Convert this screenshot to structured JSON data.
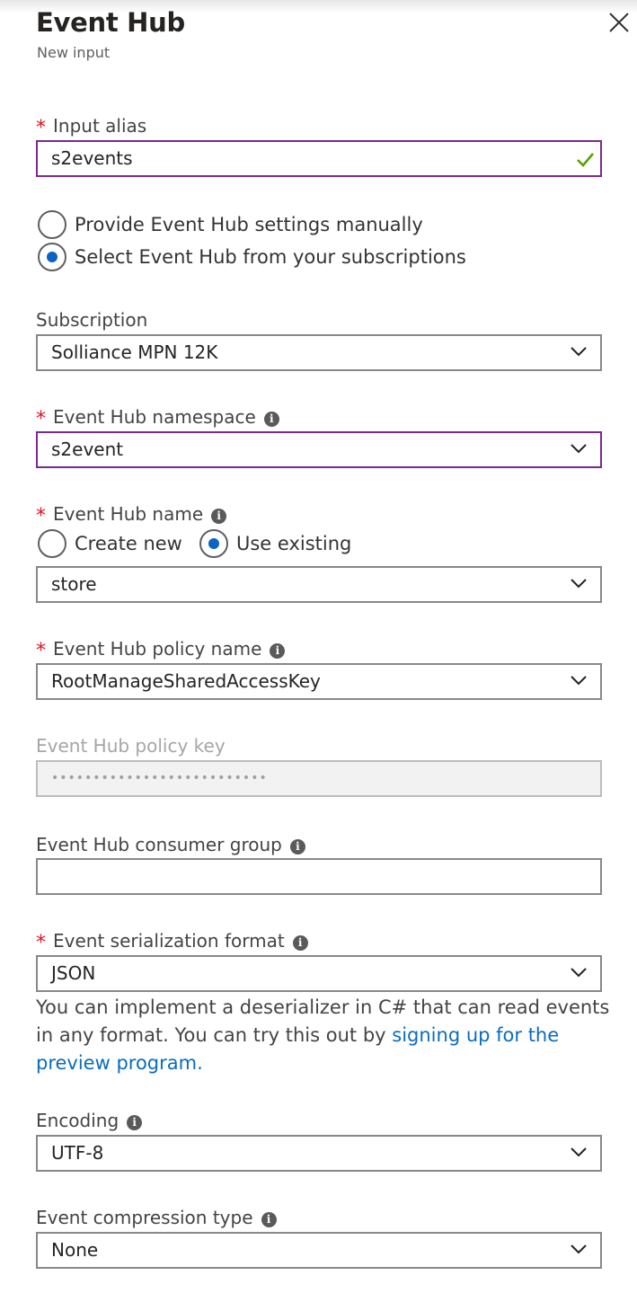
{
  "header": {
    "title": "Event Hub",
    "subtitle": "New input"
  },
  "input_alias": {
    "label": "Input alias",
    "value": "s2events",
    "required": true,
    "valid": true
  },
  "source_options": [
    {
      "label": "Provide Event Hub settings manually",
      "selected": false
    },
    {
      "label": "Select Event Hub from your subscriptions",
      "selected": true
    }
  ],
  "subscription": {
    "label": "Subscription",
    "value": "Solliance MPN 12K"
  },
  "namespace": {
    "label": "Event Hub namespace",
    "value": "s2event",
    "required": true
  },
  "hub_name": {
    "label": "Event Hub name",
    "required": true,
    "options": [
      {
        "label": "Create new",
        "selected": false
      },
      {
        "label": "Use existing",
        "selected": true
      }
    ],
    "value": "store"
  },
  "policy_name": {
    "label": "Event Hub policy name",
    "value": "RootManageSharedAccessKey",
    "required": true
  },
  "policy_key": {
    "label": "Event Hub policy key",
    "value": "••••••••••••••••••••••••••",
    "disabled": true
  },
  "consumer_group": {
    "label": "Event Hub consumer group",
    "value": ""
  },
  "serialization": {
    "label": "Event serialization format",
    "value": "JSON",
    "required": true,
    "help_text": "You can implement a deserializer in C# that can read events in any format. You can try this out by ",
    "help_link": "signing up for the preview program."
  },
  "encoding": {
    "label": "Encoding",
    "value": "UTF-8"
  },
  "compression": {
    "label": "Event compression type",
    "value": "None"
  },
  "colors": {
    "accent_blue": "#0b63c4",
    "required_red": "#e81123",
    "focus_purple": "#7a2a8f",
    "valid_green": "#57a300",
    "link": "#0b6cbd"
  },
  "icons": [
    "close-icon",
    "check-icon",
    "info-icon",
    "chevron-down-icon"
  ]
}
